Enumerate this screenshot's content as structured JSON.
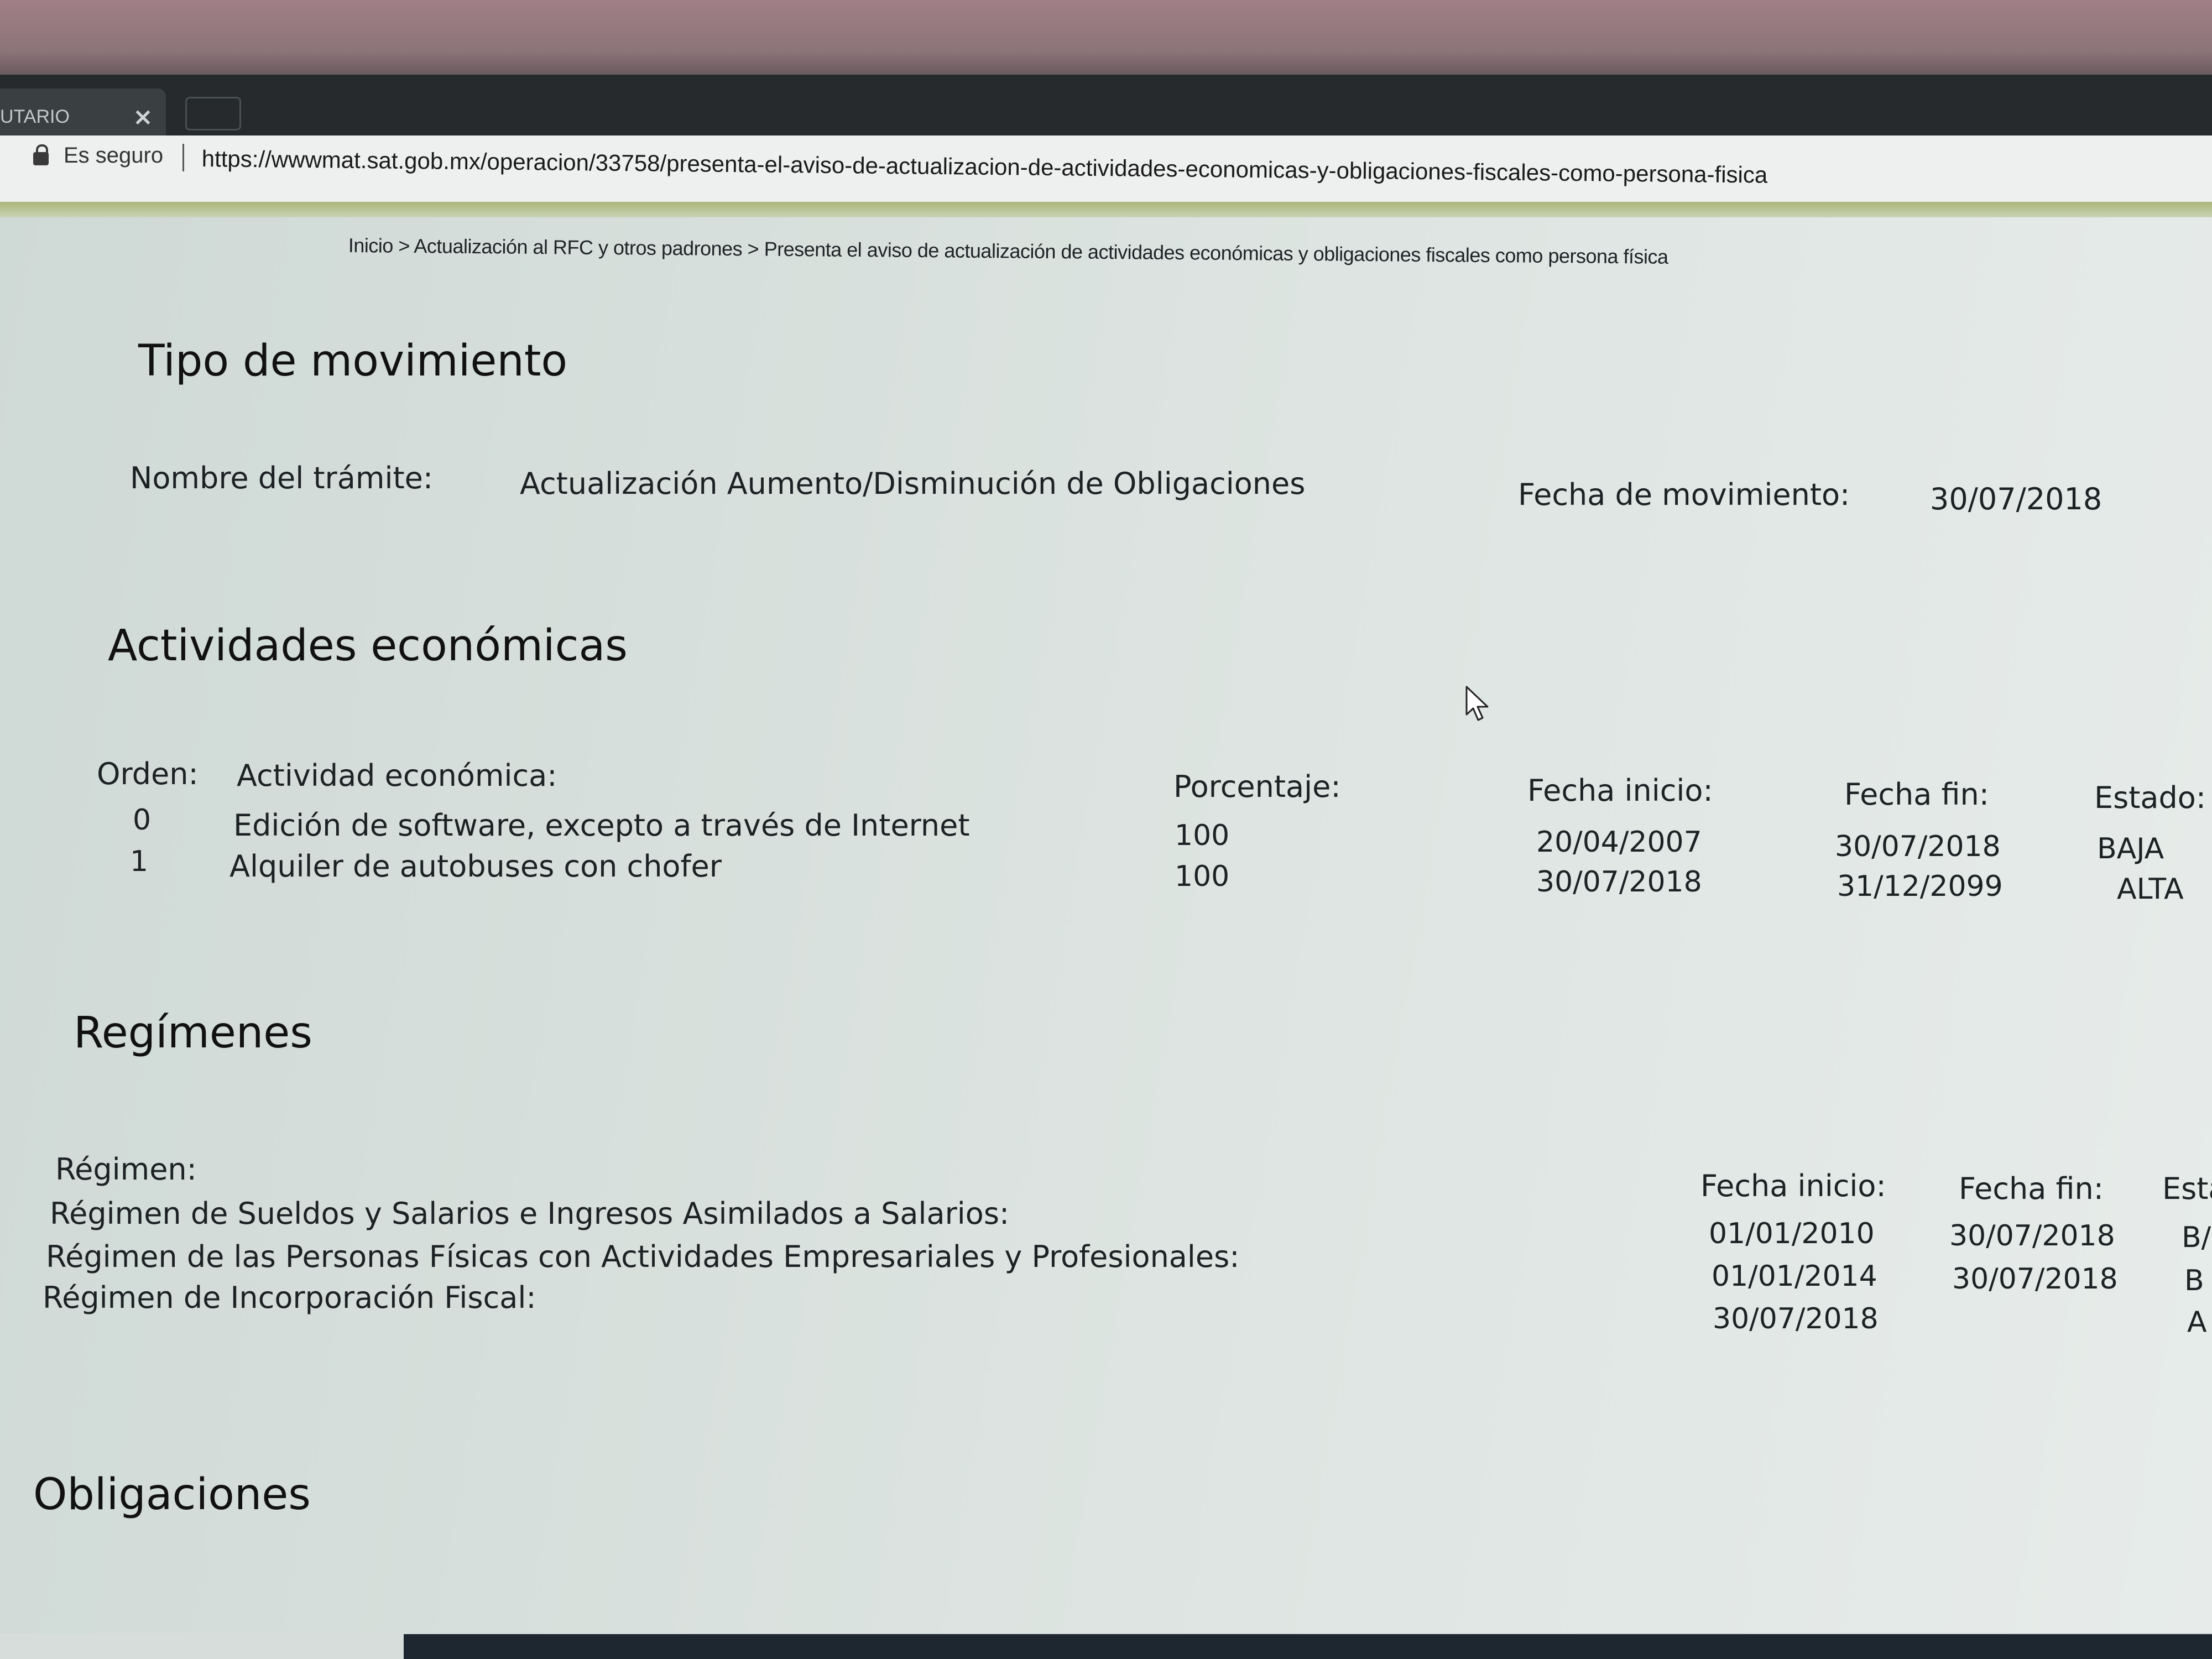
{
  "browser": {
    "tab_title": "UTARIO",
    "tab_close": "×",
    "security_label": "Es seguro",
    "url": "https://wwwmat.sat.gob.mx/operacion/33758/presenta-el-aviso-de-actualizacion-de-actividades-economicas-y-obligaciones-fiscales-como-persona-fisica"
  },
  "breadcrumb": "Inicio > Actualización al RFC y otros padrones > Presenta el aviso de actualización de actividades económicas y obligaciones fiscales como persona física",
  "movimiento": {
    "heading": "Tipo de movimiento",
    "tramite_label": "Nombre del trámite:",
    "tramite_value": "Actualización Aumento/Disminución de Obligaciones",
    "fecha_label": "Fecha de movimiento:",
    "fecha_value": "30/07/2018"
  },
  "actividades": {
    "heading": "Actividades económicas",
    "headers": {
      "orden": "Orden:",
      "actividad": "Actividad económica:",
      "porcentaje": "Porcentaje:",
      "fecha_inicio": "Fecha inicio:",
      "fecha_fin": "Fecha fin:",
      "estado": "Estado:"
    },
    "rows": [
      {
        "orden": "0",
        "actividad": "Edición de software, excepto a través de Internet",
        "porcentaje": "100",
        "fecha_inicio": "20/04/2007",
        "fecha_fin": "30/07/2018",
        "estado": "BAJA"
      },
      {
        "orden": "1",
        "actividad": "Alquiler de autobuses con chofer",
        "porcentaje": "100",
        "fecha_inicio": "30/07/2018",
        "fecha_fin": "31/12/2099",
        "estado": "ALTA"
      }
    ]
  },
  "regimenes": {
    "heading": "Regímenes",
    "headers": {
      "regimen": "Régimen:",
      "fecha_inicio": "Fecha inicio:",
      "fecha_fin": "Fecha fin:",
      "estado": "Esta"
    },
    "rows": [
      {
        "regimen": "Régimen de Sueldos y Salarios e Ingresos Asimilados a Salarios:",
        "fecha_inicio": "01/01/2010",
        "fecha_fin": "30/07/2018",
        "estado": "B/"
      },
      {
        "regimen": "Régimen de las Personas Físicas con Actividades Empresariales y Profesionales:",
        "fecha_inicio": "01/01/2014",
        "fecha_fin": "30/07/2018",
        "estado": "B"
      },
      {
        "regimen": "Régimen de Incorporación Fiscal:",
        "fecha_inicio": "30/07/2018",
        "fecha_fin": "",
        "estado": "A"
      }
    ]
  },
  "obligaciones": {
    "heading": "Obligaciones"
  }
}
